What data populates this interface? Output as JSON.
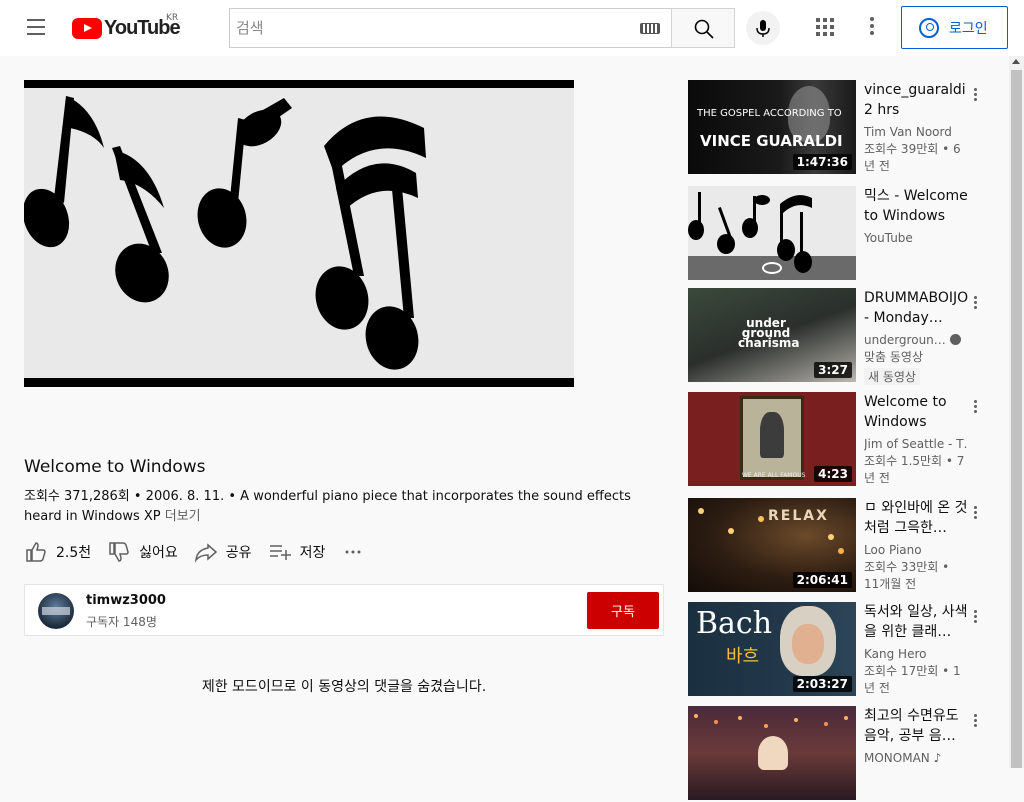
{
  "header": {
    "logo_text": "YouTube",
    "region": "KR",
    "search_placeholder": "검색",
    "login_label": "로그인"
  },
  "video": {
    "title": "Welcome to Windows",
    "views": "조회수 371,286회",
    "date": "2006. 8. 11.",
    "description": "A wonderful piano piece that incorporates the sound effects heard in Windows XP",
    "more_label": "더보기",
    "separator": " • "
  },
  "actions": {
    "like": "2.5천",
    "dislike": "싫어요",
    "share": "공유",
    "save": "저장"
  },
  "channel": {
    "name": "timwz3000",
    "subscribers": "구독자 148명",
    "subscribe_label": "구독"
  },
  "comments_note": "제한 모드이므로 이 동영상의 댓글을 숨겼습니다.",
  "related": [
    {
      "title": "vince_guaraldi 2 hrs",
      "channel": "Tim Van Noord",
      "stats": "조회수 39만회 • 6년 전",
      "duration": "1:47:36",
      "thumb_text_top": "THE GOSPEL ACCORDING TO",
      "thumb_text_main": "VINCE GUARALDI"
    },
    {
      "title": "믹스 - Welcome to Windows",
      "channel": "YouTube",
      "stats": "",
      "duration": "",
      "live_icon": "radio-icon"
    },
    {
      "title": "DRUMMABOIJO - Monday…",
      "channel": "undergroun…",
      "stats": "맞춤 동영상",
      "badge": "새 동영상",
      "duration": "3:27",
      "thumb_text_main": "under ground charisma"
    },
    {
      "title": "Welcome to Windows",
      "channel": "Jim of Seattle - T…",
      "stats": "조회수 1.5만회 • 7년 전",
      "duration": "4:23",
      "thumb_text_main": "WE ARE ALL FAMOUS"
    },
    {
      "title": "ㅁ 와인바에 온 것 처럼 그윽한…",
      "channel": "Loo Piano",
      "stats": "조회수 33만회 • 11개월 전",
      "duration": "2:06:41",
      "thumb_text_main": "RELAX"
    },
    {
      "title": "독서와 일상, 사색을 위한 클래…",
      "channel": "Kang Hero",
      "stats": "조회수 17만회 • 1년 전",
      "duration": "2:03:27",
      "thumb_text_main": "Bach",
      "thumb_text_sub": "바흐"
    },
    {
      "title": "최고의 수면유도 음악, 공부 음…",
      "channel": "MONOMAN",
      "stats": "",
      "duration": ""
    }
  ],
  "colors": {
    "brand_red": "#ff0000",
    "subscribe_red": "#cc0000",
    "link_blue": "#065fd4"
  }
}
